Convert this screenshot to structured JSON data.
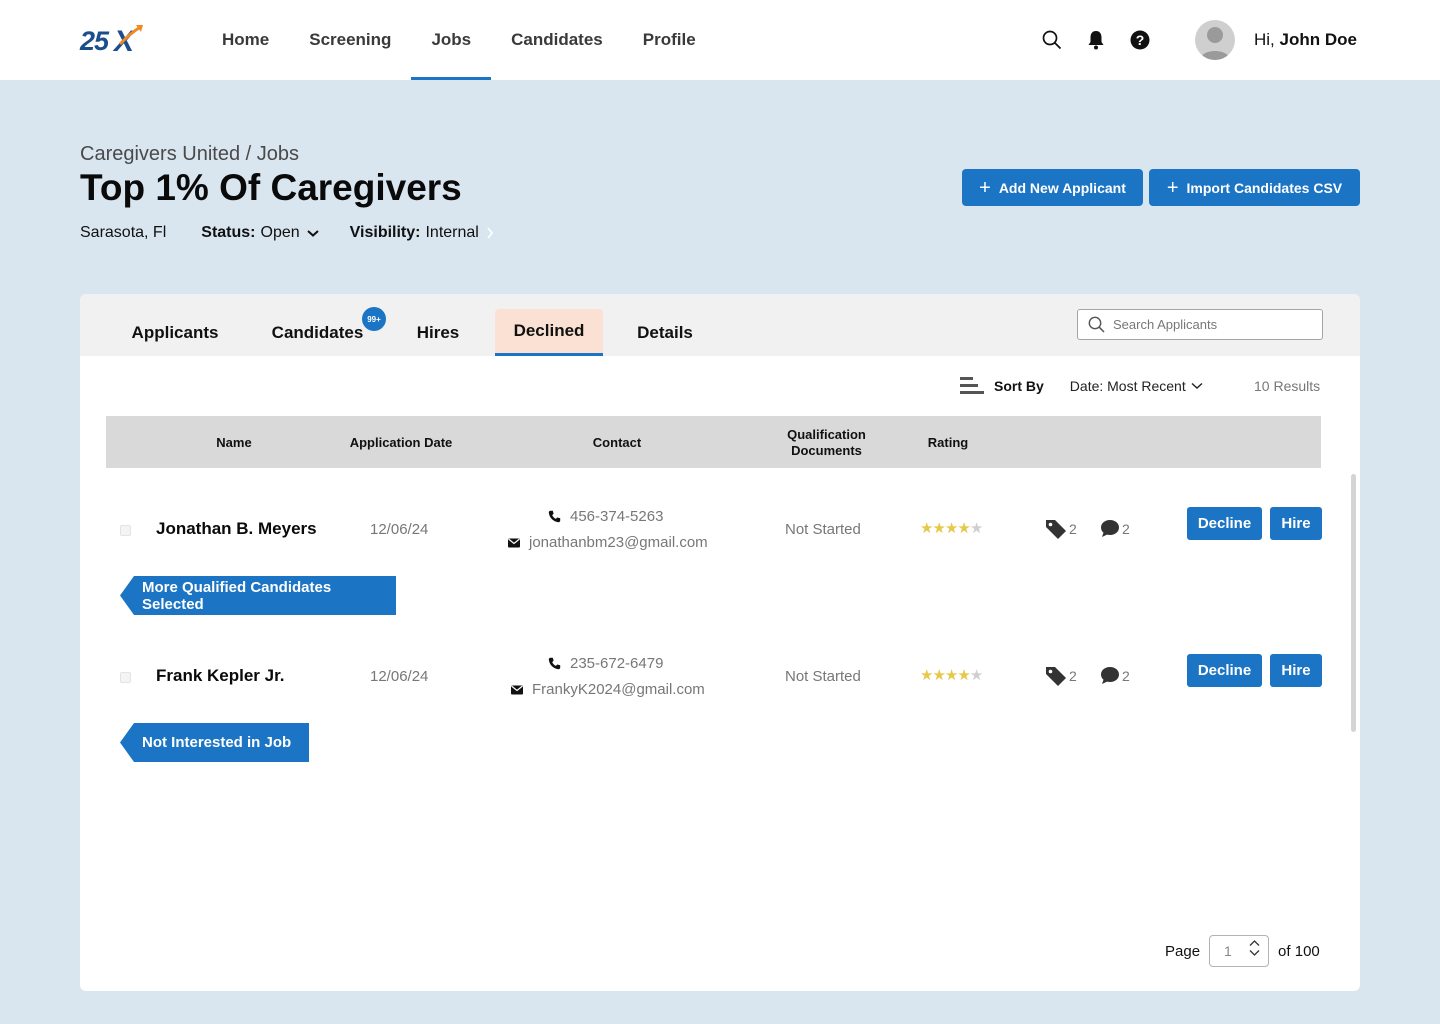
{
  "app": {
    "logo_text": "25X",
    "nav": [
      "Home",
      "Screening",
      "Jobs",
      "Candidates",
      "Profile"
    ],
    "active_nav": "Jobs",
    "greeting_prefix": "Hi,",
    "user_name": "John Doe",
    "icons": [
      "search-icon",
      "bell-icon",
      "help-icon"
    ]
  },
  "header": {
    "breadcrumb": "Caregivers United / Jobs",
    "title": "Top 1% Of Caregivers",
    "location": "Sarasota, Fl",
    "status_label": "Status:",
    "status_value": "Open",
    "visibility_label": "Visibility:",
    "visibility_value": "Internal",
    "add_applicant": "Add New Applicant",
    "import_csv": "Import Candidates CSV"
  },
  "tabs": {
    "items": [
      "Applicants",
      "Candidates",
      "Hires",
      "Declined",
      "Details"
    ],
    "active": "Declined",
    "candidates_badge": "99+"
  },
  "search": {
    "placeholder": "Search Applicants"
  },
  "sort": {
    "label": "Sort By",
    "value": "Date: Most Recent",
    "results": "10 Results"
  },
  "table": {
    "columns": [
      "Name",
      "Application Date",
      "Contact",
      "Qualification Documents",
      "Rating"
    ],
    "rows": [
      {
        "name": "Jonathan B. Meyers",
        "date": "12/06/24",
        "phone": "456-374-5263",
        "email": "jonathanbm23@gmail.com",
        "qualification": "Not Started",
        "rating": 4,
        "rating_max": 5,
        "tags": "2",
        "comments": "2",
        "decline_label": "Decline",
        "hire_label": "Hire",
        "reason": "More Qualified Candidates Selected"
      },
      {
        "name": "Frank Kepler Jr.",
        "date": "12/06/24",
        "phone": "235-672-6479",
        "email": "FrankyK2024@gmail.com",
        "qualification": "Not Started",
        "rating": 4,
        "rating_max": 5,
        "tags": "2",
        "comments": "2",
        "decline_label": "Decline",
        "hire_label": "Hire",
        "reason": "Not Interested in Job"
      }
    ]
  },
  "pagination": {
    "label": "Page",
    "current": "1",
    "total_text": "of 100"
  },
  "colors": {
    "primary": "#1b74c4",
    "background": "#d9e5ef",
    "active_tab": "#fbe1d4",
    "star": "#e6c84a"
  }
}
